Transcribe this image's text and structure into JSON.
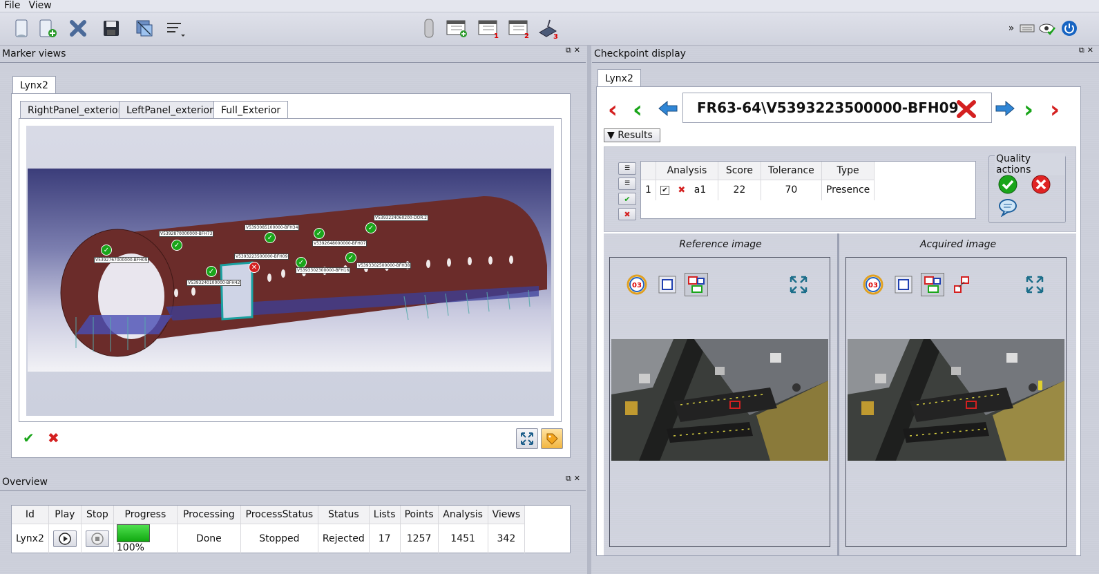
{
  "menu": {
    "file": "File",
    "view": "View"
  },
  "marker_views": {
    "title": "Marker views",
    "outer_tab": "Lynx2",
    "tabs": [
      "RightPanel_exterior",
      "LeftPanel_exterior",
      "Full_Exterior"
    ],
    "markers": [
      {
        "label": "V5392767000000-BFH09",
        "status": "ok"
      },
      {
        "label": "V5392870000000-BFH73",
        "status": "ok"
      },
      {
        "label": "V5393085100000-BFH34",
        "status": "ok"
      },
      {
        "label": "V5392648000000-BFH07",
        "status": "ok"
      },
      {
        "label": "V5393224060200-DOR.2",
        "status": "ok"
      },
      {
        "label": "V5393223500000-BFH09",
        "status": "fail"
      },
      {
        "label": "V5393240100000-BFH42",
        "status": "ok"
      },
      {
        "label": "V5393302300000-BFH16",
        "status": "ok"
      },
      {
        "label": "V5393302500000-BFH38",
        "status": "ok"
      }
    ]
  },
  "overview": {
    "title": "Overview",
    "columns": [
      "Id",
      "Play",
      "Stop",
      "Progress",
      "Processing",
      "ProcessStatus",
      "Status",
      "Lists",
      "Points",
      "Analysis",
      "Views"
    ],
    "rows": [
      {
        "id": "Lynx2",
        "progress": 1.0,
        "progress_text": "100%",
        "processing": "Done",
        "process_status": "Stopped",
        "status": "Rejected",
        "lists": "17",
        "points": "1257",
        "analysis": "1451",
        "views": "342"
      }
    ]
  },
  "checkpoint": {
    "title": "Checkpoint display",
    "tab": "Lynx2",
    "path": "FR63-64\\V5393223500000-BFH09",
    "results_label": "Results",
    "columns": [
      "Analysis",
      "Score",
      "Tolerance",
      "Type"
    ],
    "rows": [
      {
        "index": "1",
        "analysis": "a1",
        "score": "22",
        "tolerance": "70",
        "type": "Presence"
      }
    ],
    "quality_actions": "Quality actions",
    "reference_title": "Reference image",
    "acquired_title": "Acquired image",
    "badge_text": "03"
  },
  "colors": {
    "accent_green": "#1aa51a",
    "accent_red": "#d42020",
    "progress_green": "#19c419",
    "fuselage": "#6b2c2a"
  }
}
